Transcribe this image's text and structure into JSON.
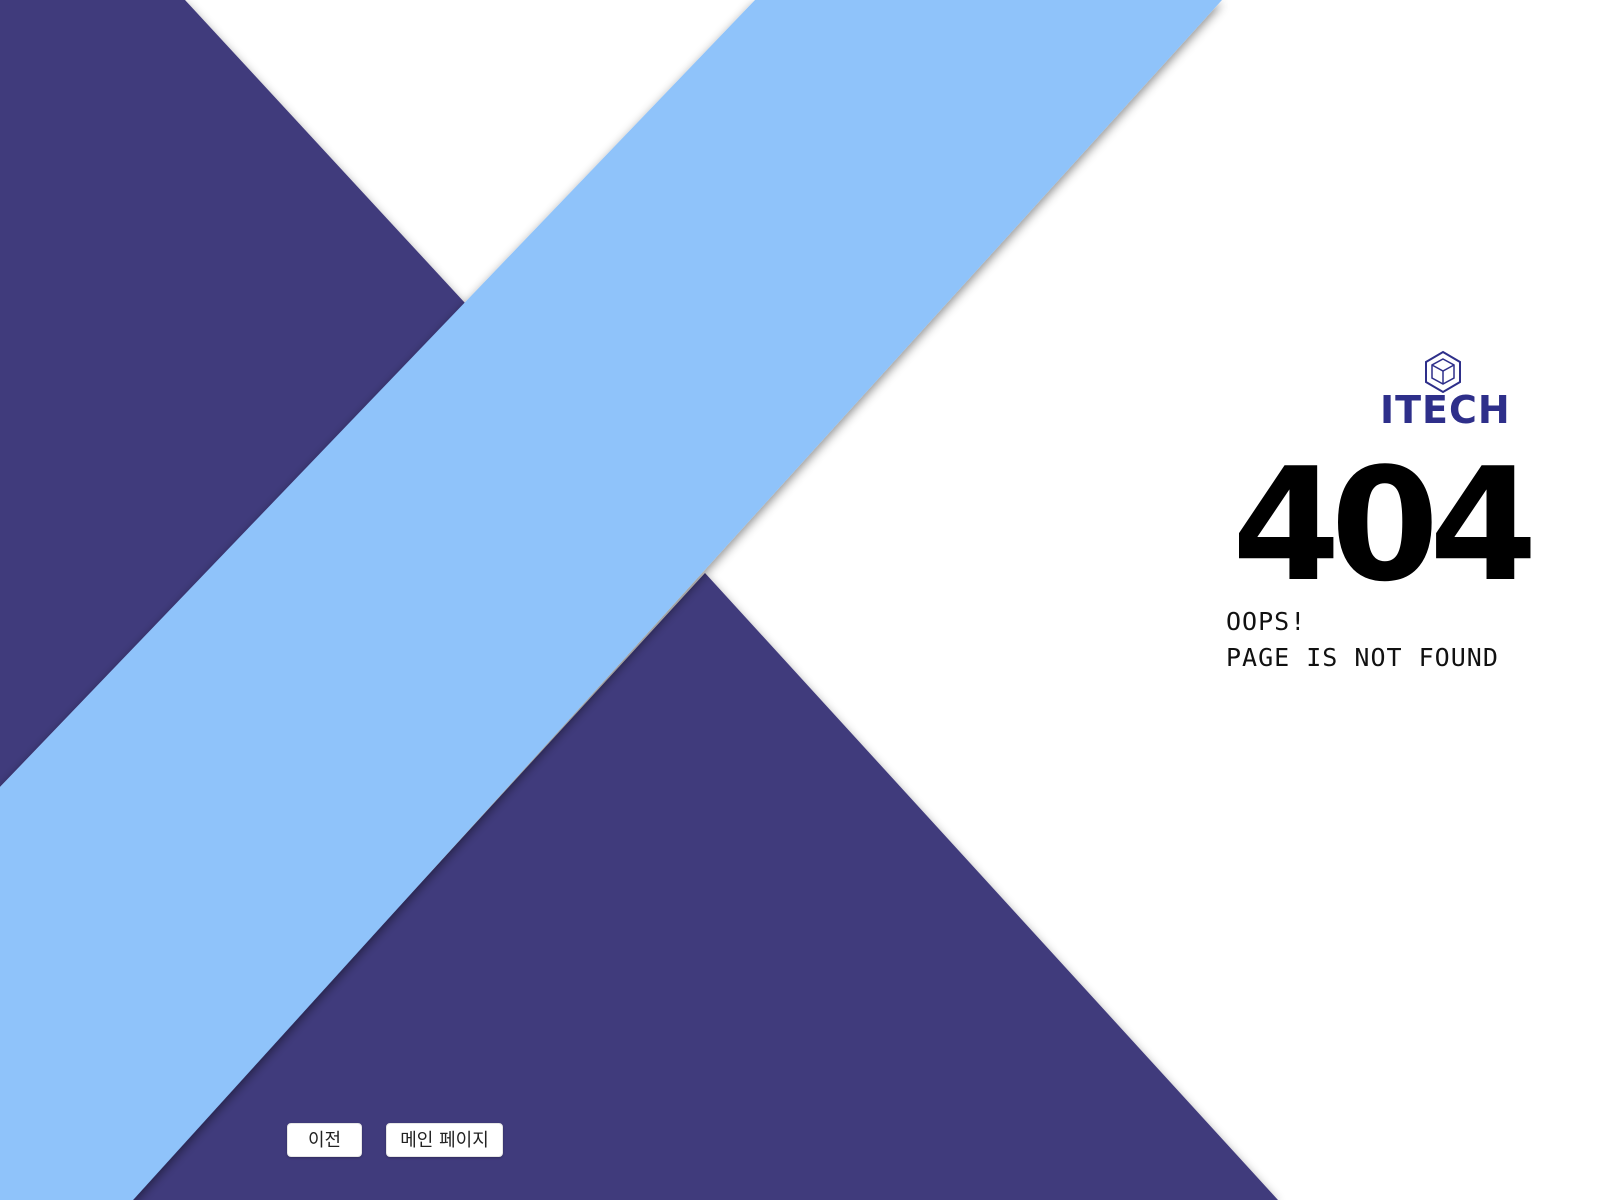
{
  "colors": {
    "background": "#ffffff",
    "dark_triangle": "#413a7c",
    "light_band": "#8fc3fa",
    "brand": "#2e2f8a",
    "text": "#000000"
  },
  "brand": {
    "logo_icon": "cube-icon",
    "name": "ITECH"
  },
  "error": {
    "code": "404",
    "line1": "OOPS!",
    "line2": "PAGE IS NOT FOUND"
  },
  "actions": {
    "back_label": "이전",
    "home_label": "메인 페이지"
  }
}
